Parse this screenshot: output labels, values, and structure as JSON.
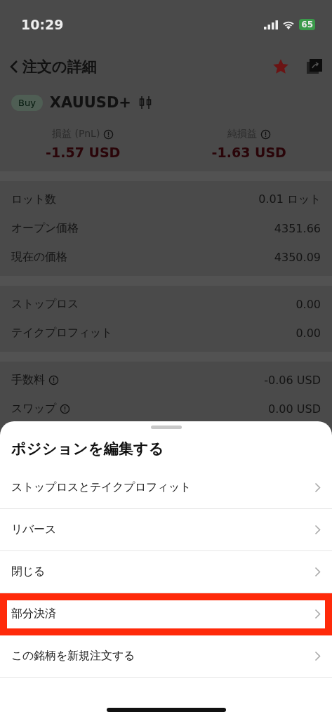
{
  "status_bar": {
    "time": "10:29",
    "battery": "65"
  },
  "nav": {
    "title": "注文の詳細",
    "favorite": true
  },
  "symbol": {
    "side": "Buy",
    "name": "XAUUSD+"
  },
  "pnl": [
    {
      "label": "損益 (PnL)",
      "value": "-1.57  USD"
    },
    {
      "label": "純損益",
      "value": "-1.63  USD"
    }
  ],
  "groups": [
    [
      {
        "label": "ロット数",
        "value": "0.01 ロット",
        "info": false
      },
      {
        "label": "オープン価格",
        "value": "4351.66",
        "info": false
      },
      {
        "label": "現在の価格",
        "value": "4350.09",
        "info": false
      }
    ],
    [
      {
        "label": "ストップロス",
        "value": "0.00",
        "info": false
      },
      {
        "label": "テイクプロフィット",
        "value": "0.00",
        "info": false
      }
    ],
    [
      {
        "label": "手数料",
        "value": "-0.06 USD",
        "info": true
      },
      {
        "label": "スワップ",
        "value": "0.00 USD",
        "info": true
      }
    ]
  ],
  "sheet": {
    "title": "ポジションを編集する",
    "items": [
      {
        "label": "ストップロスとテイクプロフィット",
        "highlighted": false
      },
      {
        "label": "リバース",
        "highlighted": false
      },
      {
        "label": "閉じる",
        "highlighted": false
      },
      {
        "label": "部分決済",
        "highlighted": true
      },
      {
        "label": "この銘柄を新規注文する",
        "highlighted": false
      }
    ]
  }
}
